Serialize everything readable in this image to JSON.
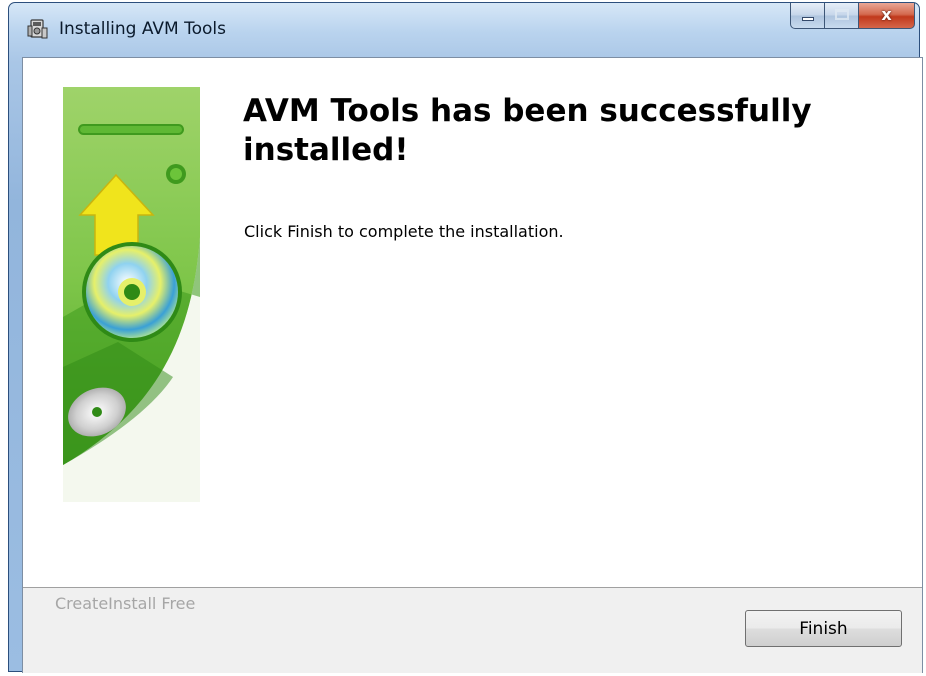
{
  "window": {
    "title": "Installing AVM Tools",
    "app_icon": "installer-icon",
    "controls": {
      "minimize_icon": "minimize-icon",
      "maximize_icon": "maximize-icon",
      "close_icon": "close-icon",
      "close_glyph": "x"
    }
  },
  "content": {
    "heading": "AVM Tools has been successfully installed!",
    "instruction": "Click Finish to complete the installation.",
    "banner_image": "installer-banner-disc-arrow"
  },
  "footer": {
    "brand": "CreateInstall Free",
    "finish_label": "Finish"
  },
  "colors": {
    "close_button": "#c1391c",
    "banner_green": "#5fbb2e",
    "arrow_yellow": "#efe21a"
  }
}
